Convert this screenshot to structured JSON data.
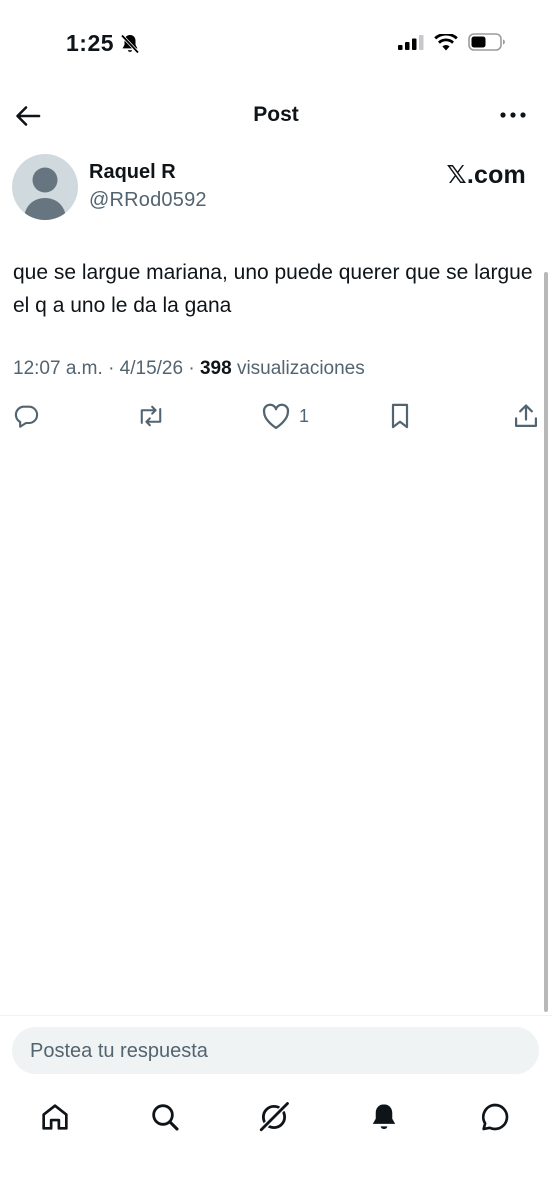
{
  "status_bar": {
    "time": "1:25",
    "icons": [
      "bell-slash-icon",
      "signal-icon",
      "wifi-icon",
      "battery-icon"
    ]
  },
  "header": {
    "title": "Post",
    "back_icon": "arrow-left-icon",
    "more_icon": "more-horizontal-icon"
  },
  "post": {
    "author": {
      "display_name": "Raquel R",
      "handle": "@RRod0592",
      "avatar": "default-avatar"
    },
    "brand": "𝕏.com",
    "text": "que se largue mariana, uno puede querer que se largue el q a uno le da la gana",
    "time": "12:07 a.m.",
    "date": "4/15/26",
    "views_count": "398",
    "views_label": "visualizaciones",
    "actions": {
      "reply_icon": "comment-icon",
      "repost_icon": "repost-icon",
      "like_icon": "heart-icon",
      "like_count": "1",
      "bookmark_icon": "bookmark-icon",
      "share_icon": "share-icon"
    }
  },
  "reply": {
    "placeholder": "Postea tu respuesta"
  },
  "bottom_nav": {
    "items": [
      "home-icon",
      "search-icon",
      "grok-icon",
      "notifications-icon",
      "messages-icon"
    ]
  },
  "colors": {
    "text_primary": "#0f1419",
    "text_secondary": "#536471",
    "avatar_bg": "#cfd9de",
    "input_bg": "#eff3f4"
  }
}
